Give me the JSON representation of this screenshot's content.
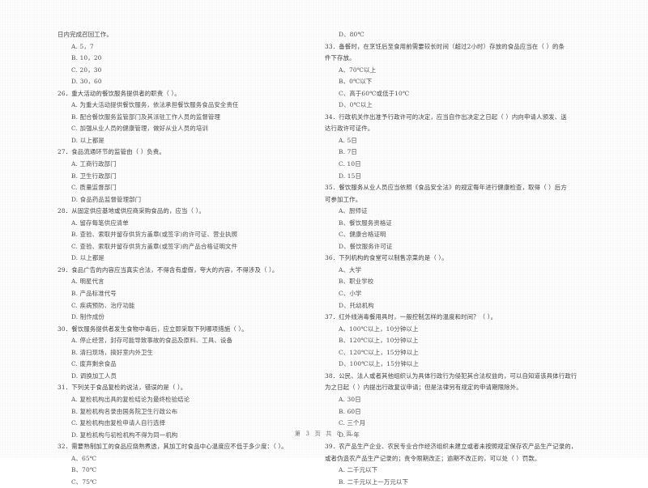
{
  "document": {
    "page_footer": {
      "prefix": "第",
      "current_page": "3",
      "middle": "页  共",
      "total_pages": "8",
      "suffix": "页",
      "full_text": "第 3 页 共 8 页"
    }
  },
  "left_column": {
    "continued_line": "日内完成召回工作。",
    "continued_options": [
      "A. 5，7",
      "B. 10，20",
      "C. 20，30",
      "D. 30，60"
    ],
    "questions": [
      {
        "number": "26．",
        "stem": "重大活动的餐饮服务提供者的职责（      ）。",
        "options": [
          "A. 为重大活动提供餐饮服务，依法承担餐饮服务食品安全责任",
          "B. 配合餐饮服务监管部门及其派驻工作人员的监督管理",
          "C. 加强从业人员的健康管理，做好从业人员的培训",
          "D. 以上都是"
        ]
      },
      {
        "number": "27．",
        "stem": "食品流通环节的监管由（      ）负责。",
        "options": [
          "A. 工商行政部门",
          "B. 卫生行政部门",
          "C. 质量监督部门",
          "D. 食品药品监督管理部门"
        ]
      },
      {
        "number": "28．",
        "stem": "从固定供应基地或供应商采购食品的，应当（      ）。",
        "options": [
          "A. 留存每笔供应清单",
          "B. 查验、索取并留存供货方盖章(或签字)的许可证、营业执照",
          "C. 查验、索取并留存供货方盖章(或签字)的产品合格证明文件",
          "D. 以上都是"
        ]
      },
      {
        "number": "29．",
        "stem": "食品广告的内容应当真实合法，不得含有虚假，夸大的内容，不得涉及（      ）。",
        "options": [
          "A. 明星代言",
          "B. 产品标准代号",
          "C. 疾病预防、治疗功能",
          "D. 制作成份"
        ]
      },
      {
        "number": "30．",
        "stem": "餐饮服务提供者发生食物中毒后，应立即采取下列哪项措施（      ）。",
        "options": [
          "A. 停止经营，封存可能导致事故的食品及原料、工具、设备",
          "B. 清扫现场，搞好室内外卫生",
          "C. 废弃剩余食品",
          "D. 调换加工人员"
        ]
      },
      {
        "number": "31．",
        "stem": "下列关于食品复检的说法，错误的是（      ）。",
        "options": [
          "A. 复检机构出具的复检结论为最终检验结论",
          "B. 复检机构名录由国务院卫生行政公布",
          "C. 复检机构由复检申请人自行选择",
          "D. 复检机构与初检机构不得为同一机构"
        ]
      },
      {
        "number": "32．",
        "stem": "需要熟制加工的食品应烧熟煮透，其加工时食品中心温度应不低于多少度：（      ）。",
        "options": [
          "A、65℃",
          "B、70℃",
          "C、75℃"
        ]
      }
    ]
  },
  "right_column": {
    "continued_options": [
      "D、80℃"
    ],
    "questions": [
      {
        "number": "33．",
        "stem": "备餐时，在烹饪后至食用前需要较长时间（超过2小时）存放的食品应当在（      ）的条",
        "stem_continued": "件下存放。",
        "options": [
          "A、70℃以上",
          "B、0℃以下",
          "C、高于60℃或低于10℃",
          "D、0℃以上"
        ]
      },
      {
        "number": "34．",
        "stem": "行政机关作出准予行政许可的决定，应当自作出决定之日起（      ）内向申请人颁发、送",
        "stem_continued": "达行政许可证件。",
        "options": [
          "A. 5日",
          "B. 7日",
          "C. 10日",
          "D. 15日"
        ]
      },
      {
        "number": "35．",
        "stem": "餐饮服务从业人员应当依照《食品安全法》的规定每年进行健康检查，取得（      ）后方",
        "stem_continued": "可参加工作。",
        "options": [
          "A、厨师证",
          "B、餐饮服务资格证",
          "C、健康合格证明",
          "D、餐饮服务许可证"
        ]
      },
      {
        "number": "36．",
        "stem": "下列机构的食堂可以制售凉菜的是（      ）。",
        "options": [
          "A、大学",
          "B、职业学校",
          "C、小学",
          "D、托幼机构"
        ]
      },
      {
        "number": "37．",
        "stem": "红外线消毒餐用具时，一般控制怎样的温度和时间？（      ）。",
        "options": [
          "A、100℃以上，10分钟以上",
          "B、120℃以上，10分钟以上",
          "C、120℃以上，15分钟以上",
          "D、100℃以上，15分钟以上"
        ]
      },
      {
        "number": "38．",
        "stem": "公民、法人或者其他组织认为具体行政行为侵犯其合法权益的，可以自知道该具体行政行",
        "stem_continued": "为之日起（      ）内提出行政复议申请；但是法律另有规定的申请期限除外。",
        "options": [
          "A. 30日",
          "B. 60日",
          "C. 三个月",
          "D. 一年"
        ]
      },
      {
        "number": "39．",
        "stem": "农产品生产企业、农民专业合作经济组织未建立或者未按照规定保存农产品生产记录的，",
        "stem_continued": "或者伪造农产品生产记录的；责令限期改正；逾期不改正的，可以处（      ）罚款。",
        "options": [
          "A. 二千元以下",
          "B. 二千元以上一万元以下"
        ]
      }
    ]
  }
}
